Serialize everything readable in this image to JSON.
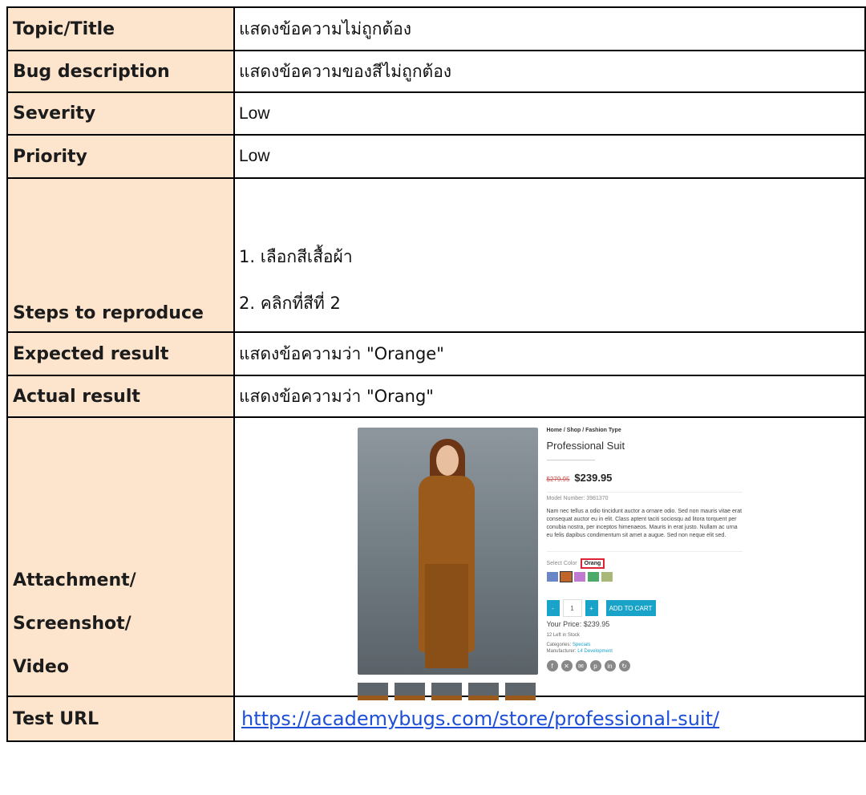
{
  "rows": {
    "topic": {
      "label": "Topic/Title",
      "value": "แสดงข้อความไม่ถูกต้อง"
    },
    "bug": {
      "label": "Bug description",
      "value": "แสดงข้อความของสีไม่ถูกต้อง"
    },
    "severity": {
      "label": "Severity",
      "value": "Low"
    },
    "priority": {
      "label": "Priority",
      "value": "Low"
    },
    "steps": {
      "label": "Steps to reproduce",
      "items": [
        "1. เลือกสีเสื้อผ้า",
        "2. คลิกที่สีที่ 2"
      ]
    },
    "expected": {
      "label": "Expected result",
      "value": "แสดงข้อความว่า \"Orange\""
    },
    "actual": {
      "label": "Actual result",
      "value": "แสดงข้อความว่า \"Orang\""
    },
    "attachment": {
      "label_lines": [
        "Attachment/",
        "Screenshot/",
        "Video"
      ]
    },
    "url": {
      "label": "Test URL",
      "value": "https://academybugs.com/store/professional-suit/"
    }
  },
  "screenshot": {
    "breadcrumb": "Home / Shop / Fashion Type",
    "product_title": "Professional Suit",
    "old_price": "$279.95",
    "price": "$239.95",
    "model": "Model Number: 3981370",
    "description": "Nam nec tellus a odio tincidunt auctor a ornare odio. Sed non mauris vitae erat consequat auctor eu in elit. Class aptent taciti sociosqu ad litora torquent per conubia nostra, per inceptos himenaeos. Mauris in erat justo. Nullam ac urna eu felis dapibus condimentum sit amet a augue. Sed non neque elit sed.",
    "select_color_label": "Select Color",
    "selected_color": "Orang",
    "swatch_colors": [
      "#6a86c4",
      "#c0662a",
      "#c07ad0",
      "#4caa6a",
      "#a8b878"
    ],
    "qty": "1",
    "minus": "-",
    "plus": "+",
    "add_to_cart": "ADD TO CART",
    "your_price": "Your Price: $239.95",
    "stock": "12 Left in Stock",
    "categories_label": "Categories:",
    "categories": "Specials",
    "manufacturer_label": "Manufacturer:",
    "manufacturer": "L4 Development"
  }
}
